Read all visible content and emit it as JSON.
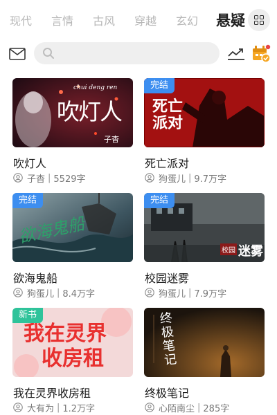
{
  "tabs": [
    {
      "label": "现代",
      "active": false
    },
    {
      "label": "言情",
      "active": false
    },
    {
      "label": "古风",
      "active": false
    },
    {
      "label": "穿越",
      "active": false
    },
    {
      "label": "玄幻",
      "active": false
    },
    {
      "label": "悬疑",
      "active": true
    }
  ],
  "header_icons": {
    "menu": "grid-icon",
    "mail": "mail-icon",
    "search": "search-icon",
    "trend": "trend-icon",
    "calendar": "calendar-icon"
  },
  "search": {
    "placeholder": ""
  },
  "books": [
    {
      "title": "吹灯人",
      "author": "子杳",
      "words": "5529字",
      "badge": "",
      "cover_title": "吹灯人",
      "cover_pinyin": "chui deng ren",
      "cover_author": "子杳"
    },
    {
      "title": "死亡派对",
      "author": "狗蛋儿",
      "words": "9.7万字",
      "badge": "完结",
      "cover_title_1": "死亡",
      "cover_title_2": "派对"
    },
    {
      "title": "欲海鬼船",
      "author": "狗蛋儿",
      "words": "8.4万字",
      "badge": "完结",
      "cover_title": "欲海鬼船"
    },
    {
      "title": "校园迷雾",
      "author": "狗蛋儿",
      "words": "7.9万字",
      "badge": "完结",
      "cover_small": "校园",
      "cover_big": "迷雾"
    },
    {
      "title": "我在灵界收房租",
      "author": "大有为",
      "words": "1.2万字",
      "badge": "新书",
      "cover_title_1": "我在灵界",
      "cover_title_2": "收房租"
    },
    {
      "title": "终极笔记",
      "author": "心陌南尘",
      "words": "285字",
      "badge": "",
      "cover_title": "终极笔记"
    }
  ],
  "colors": {
    "badge_done": "#3d8ef0",
    "badge_new": "#2fc39a",
    "calendar": "#f5a623",
    "notify_dot": "#e84545"
  }
}
